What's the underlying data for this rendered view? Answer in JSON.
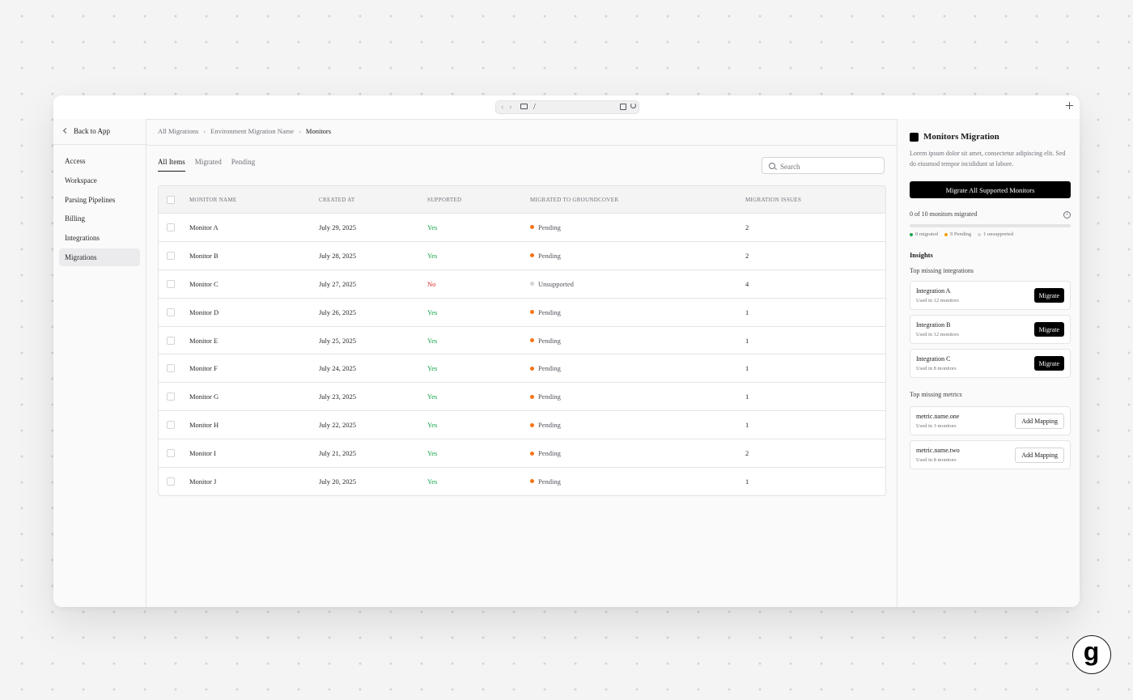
{
  "browser": {
    "url": "/"
  },
  "sidebar": {
    "back_label": "Back to App",
    "items": [
      {
        "label": "Access",
        "active": false
      },
      {
        "label": "Workspace",
        "active": false
      },
      {
        "label": "Parsing Pipelines",
        "active": false
      },
      {
        "label": "Billing",
        "active": false
      },
      {
        "label": "Integrations",
        "active": false
      },
      {
        "label": "Migrations",
        "active": true
      }
    ]
  },
  "breadcrumb": [
    "All Migrations",
    "Environment Migration Name",
    "Monitors"
  ],
  "tabs": [
    {
      "label": "All Items",
      "active": true
    },
    {
      "label": "Migrated",
      "active": false
    },
    {
      "label": "Pending",
      "active": false
    }
  ],
  "search": {
    "placeholder": "Search",
    "value": ""
  },
  "table": {
    "headers": [
      "Monitor Name",
      "Created At",
      "Supported",
      "Migrated to groundcover",
      "Migration Issues"
    ],
    "rows": [
      {
        "name": "Monitor A",
        "created": "July 29, 2025",
        "supported": "Yes",
        "status": "Pending",
        "issues": "2"
      },
      {
        "name": "Monitor B",
        "created": "July 28, 2025",
        "supported": "Yes",
        "status": "Pending",
        "issues": "2"
      },
      {
        "name": "Monitor C",
        "created": "July 27, 2025",
        "supported": "No",
        "status": "Unsupported",
        "issues": "4"
      },
      {
        "name": "Monitor D",
        "created": "July 26, 2025",
        "supported": "Yes",
        "status": "Pending",
        "issues": "1"
      },
      {
        "name": "Monitor E",
        "created": "July 25, 2025",
        "supported": "Yes",
        "status": "Pending",
        "issues": "1"
      },
      {
        "name": "Monitor F",
        "created": "July 24, 2025",
        "supported": "Yes",
        "status": "Pending",
        "issues": "1"
      },
      {
        "name": "Monitor G",
        "created": "July 23, 2025",
        "supported": "Yes",
        "status": "Pending",
        "issues": "1"
      },
      {
        "name": "Monitor H",
        "created": "July 22, 2025",
        "supported": "Yes",
        "status": "Pending",
        "issues": "1"
      },
      {
        "name": "Monitor I",
        "created": "July 21, 2025",
        "supported": "Yes",
        "status": "Pending",
        "issues": "2"
      },
      {
        "name": "Monitor J",
        "created": "July 20, 2025",
        "supported": "Yes",
        "status": "Pending",
        "issues": "1"
      }
    ]
  },
  "panel": {
    "title": "Monitors Migration",
    "description": "Lorem ipsum dolor sit amet, consectetur adipiscing elit. Sed do eiusmod tempor incididunt ut labore.",
    "migrate_all_label": "Migrate All Supported Monitors",
    "progress_label": "0 of 10 monitors migrated",
    "progress_fraction": 0,
    "legend": [
      {
        "label": "0 migrated",
        "color": "#16a34a"
      },
      {
        "label": "9 Pending",
        "color": "#f59e0b"
      },
      {
        "label": "1 unsupported",
        "color": "#d4d4d8"
      }
    ],
    "insights_title": "Insights",
    "integrations_title": "Top missing integrations",
    "integrations": [
      {
        "name": "Integration A",
        "usage": "Used in 12 monitors",
        "action": "Migrate"
      },
      {
        "name": "Integration B",
        "usage": "Used in 12 monitors",
        "action": "Migrate"
      },
      {
        "name": "Integration C",
        "usage": "Used in 8 monitors",
        "action": "Migrate"
      }
    ],
    "metrics_title": "Top missing metrics",
    "metrics": [
      {
        "name": "metric.name.one",
        "usage": "Used in 3 monitors",
        "action": "Add Mapping"
      },
      {
        "name": "metric.name.two",
        "usage": "Used in 8 monitors",
        "action": "Add Mapping"
      }
    ]
  },
  "colors": {
    "yes": "#16a34a",
    "no": "#dc2626",
    "pending": "#f97316",
    "unsupported": "#d4d4d8",
    "accent": "#000000"
  },
  "logo": {
    "letter": "g"
  }
}
